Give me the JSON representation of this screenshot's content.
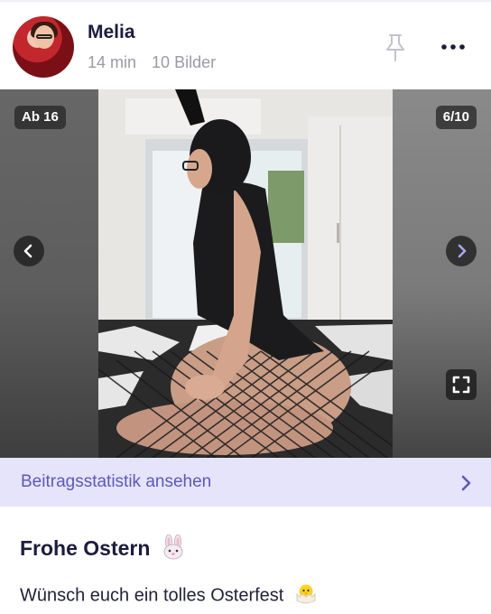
{
  "post": {
    "author": "Melia",
    "time_ago": "14 min",
    "image_count": "10 Bilder",
    "age_badge": "Ab 16",
    "image_position": "6/10",
    "stats_label": "Beitragsstatistik ansehen",
    "title": "Frohe Ostern",
    "body": "Wünsch euch ein tolles Osterfest"
  },
  "icons": {
    "pin": "pin-icon",
    "more": "more-dots-icon",
    "prev": "chevron-left-icon",
    "next": "chevron-right-icon",
    "fullscreen": "fullscreen-icon",
    "stats": "chevron-right-icon",
    "title_emoji": "rabbit-face-emoji",
    "body_emoji": "hatching-chick-emoji"
  },
  "colors": {
    "accent": "#5e58b8",
    "stats_bar_bg": "#e5e4fb",
    "username": "#1c1c3c",
    "meta": "#9a9aa8"
  }
}
